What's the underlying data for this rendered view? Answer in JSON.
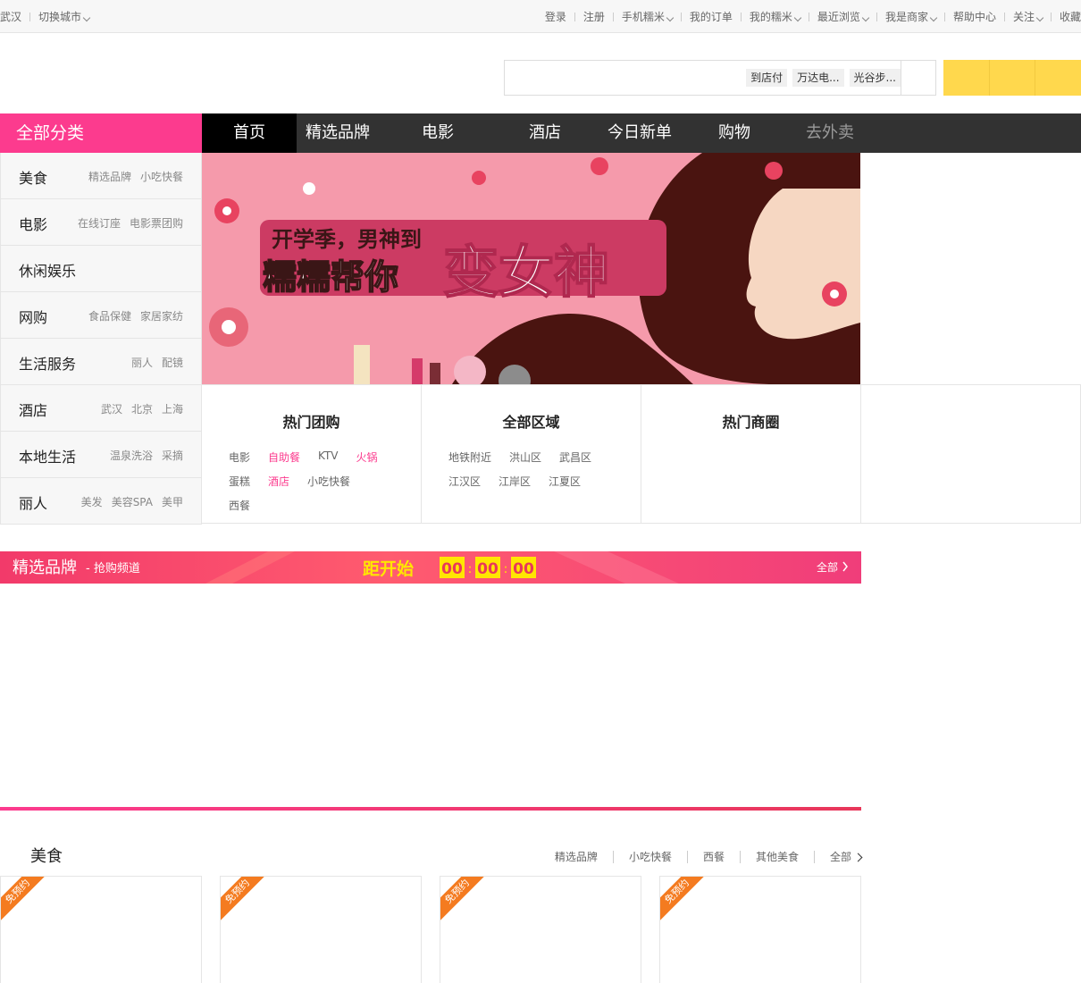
{
  "topbar": {
    "city": "武汉",
    "switch_city": "切换城市",
    "links": [
      "登录",
      "注册",
      "手机糯米",
      "我的订单",
      "我的糯米",
      "最近浏览",
      "我是商家",
      "帮助中心",
      "关注",
      "收藏"
    ]
  },
  "search": {
    "placeholder": "",
    "tags": [
      "到店付",
      "万达电...",
      "光谷步..."
    ]
  },
  "category_header": "全部分类",
  "nav": {
    "items": [
      "首页",
      "精选品牌",
      "电影",
      "酒店",
      "今日新单",
      "购物",
      "去外卖"
    ]
  },
  "categories": [
    {
      "name": "美食",
      "subs": [
        "精选品牌",
        "小吃快餐"
      ]
    },
    {
      "name": "电影",
      "subs": [
        "在线订座",
        "电影票团购"
      ]
    },
    {
      "name": "休闲娱乐",
      "subs": []
    },
    {
      "name": "网购",
      "subs": [
        "食品保健",
        "家居家纺"
      ]
    },
    {
      "name": "生活服务",
      "subs": [
        "丽人",
        "配镜"
      ]
    },
    {
      "name": "酒店",
      "subs": [
        "武汉",
        "北京",
        "上海"
      ]
    },
    {
      "name": "本地生活",
      "subs": [
        "温泉洗浴",
        "采摘"
      ]
    },
    {
      "name": "丽人",
      "subs": [
        "美发",
        "美容SPA",
        "美甲"
      ]
    }
  ],
  "banner": {
    "line1": "开学季，男神到",
    "line2": "糯糯帮你",
    "line3": "变女神"
  },
  "panels": {
    "hot_deals": {
      "title": "热门团购",
      "links": [
        "电影",
        "自助餐",
        "KTV",
        "火锅",
        "蛋糕",
        "酒店",
        "小吃快餐",
        "西餐"
      ]
    },
    "areas": {
      "title": "全部区域",
      "links": [
        "地铁附近",
        "洪山区",
        "武昌区",
        "江汉区",
        "江岸区",
        "江夏区"
      ]
    },
    "business": {
      "title": "热门商圈",
      "links": []
    }
  },
  "brand_bar": {
    "title": "精选品牌",
    "subtitle": "- 抢购频道",
    "countdown_label": "距开始",
    "hh": "00",
    "mm": "00",
    "ss": "00",
    "all": "全部"
  },
  "food_section": {
    "title": "美食",
    "links": [
      "精选品牌",
      "小吃快餐",
      "西餐",
      "其他美食",
      "全部"
    ],
    "ribbon": "免预约"
  },
  "colors": {
    "brand_pink": "#fc3b8e",
    "nav_dark": "#323232",
    "yellow": "#ffd84d",
    "ribbon_orange": "#f47b20"
  }
}
